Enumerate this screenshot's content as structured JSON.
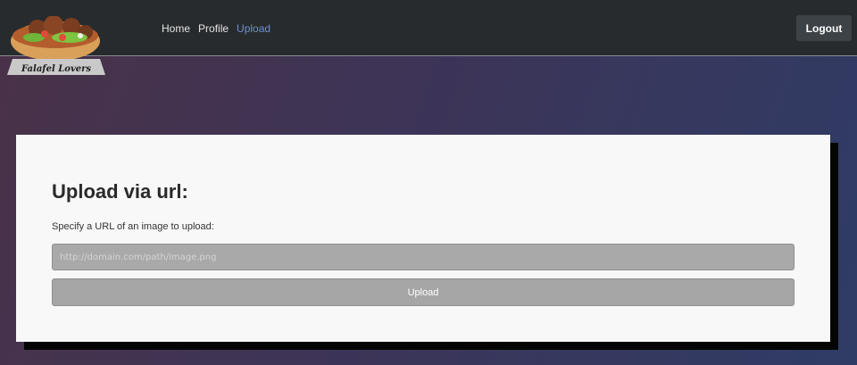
{
  "brand": {
    "logo_text": "Falafel Lovers"
  },
  "nav": {
    "links": [
      {
        "label": "Home"
      },
      {
        "label": "Profile"
      },
      {
        "label": "Upload"
      }
    ],
    "logout_label": "Logout"
  },
  "upload_form": {
    "title": "Upload via url:",
    "label": "Specify a URL of an image to upload:",
    "url_placeholder": "http://domain.com/path/image.png",
    "url_value": "",
    "submit_label": "Upload"
  },
  "colors": {
    "navbar": "#272b2e",
    "active_link": "#6f8fd0",
    "card": "#f8f8f8"
  }
}
